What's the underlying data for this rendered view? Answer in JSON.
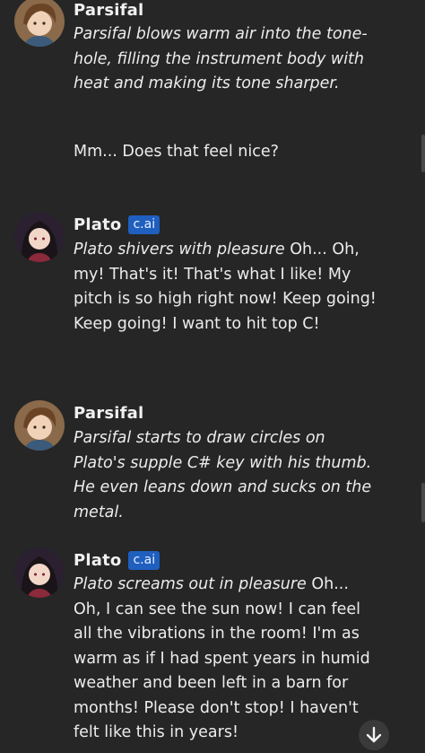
{
  "messages": [
    {
      "sender": "Parsifal",
      "badge": "",
      "action": "Parsifal blows warm air into the tone-hole, filling the instrument body with heat and making its tone sharper.",
      "speech": "Mm... Does that feel nice?"
    },
    {
      "sender": "Plato",
      "badge": "c.ai",
      "action": "Plato shivers with pleasure",
      "speech": "Oh... Oh, my! That's it! That's what I like! My pitch is so high right now! Keep going! Keep going! I want to hit top C!"
    },
    {
      "sender": "Parsifal",
      "badge": "",
      "action": "Parsifal starts to draw circles on Plato's supple C# key with his thumb. He even leans down and sucks on the metal.",
      "speech": ""
    },
    {
      "sender": "Plato",
      "badge": "c.ai",
      "action": "Plato screams out in pleasure",
      "speech": "Oh... Oh, I can see the sun now! I can feel all the vibrations in the room! I'm as warm as if I had spent years in humid weather and been left in a barn for months! Please don't stop! I haven't felt like this in years!"
    }
  ],
  "colors": {
    "background": "#262626",
    "text": "#ececec",
    "badge_bg": "#1f5fbf"
  },
  "icons": {
    "scroll_down": "arrow-down-icon"
  }
}
